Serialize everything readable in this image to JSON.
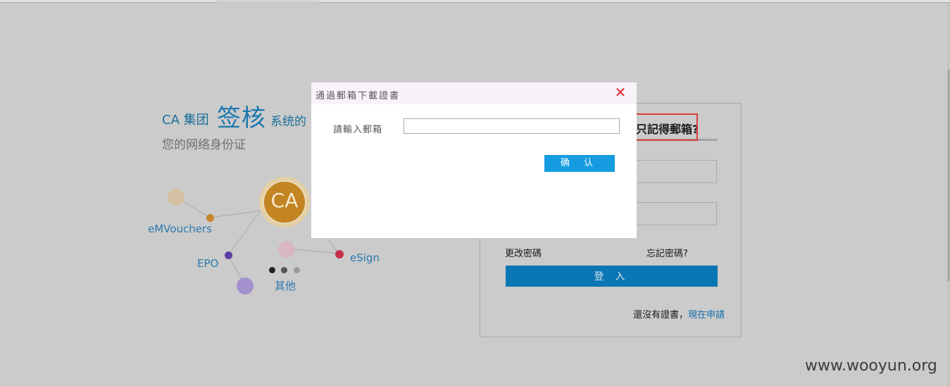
{
  "brand": {
    "prefix": "CA 集团",
    "name": "签核",
    "suffix": "系统的",
    "tagline": "您的网络身份证"
  },
  "diagram": {
    "center_label": "CA",
    "nodes": [
      "eMVouchers",
      "EPO",
      "eSign",
      "其他"
    ]
  },
  "login": {
    "highlight_text": "只記得郵箱?",
    "change_password": "更改密碼",
    "forgot_password": "忘記密碼?",
    "login_button": "登 入",
    "no_cert_text": "還沒有證書，",
    "apply_link": "現在申請"
  },
  "modal": {
    "title": "通過郵箱下載證書",
    "close_icon": "close-icon",
    "email_label": "請輸入郵箱",
    "email_value": "",
    "email_placeholder": "",
    "confirm_button": "确 认"
  },
  "watermark": "www.wooyun.org",
  "colors": {
    "overlay": "#cbcbcb",
    "accent": "#159ce0",
    "login_button": "#0a76b4",
    "close": "#e0262a",
    "highlight_box": "#d93c3c",
    "ca_orange": "#c38422"
  }
}
